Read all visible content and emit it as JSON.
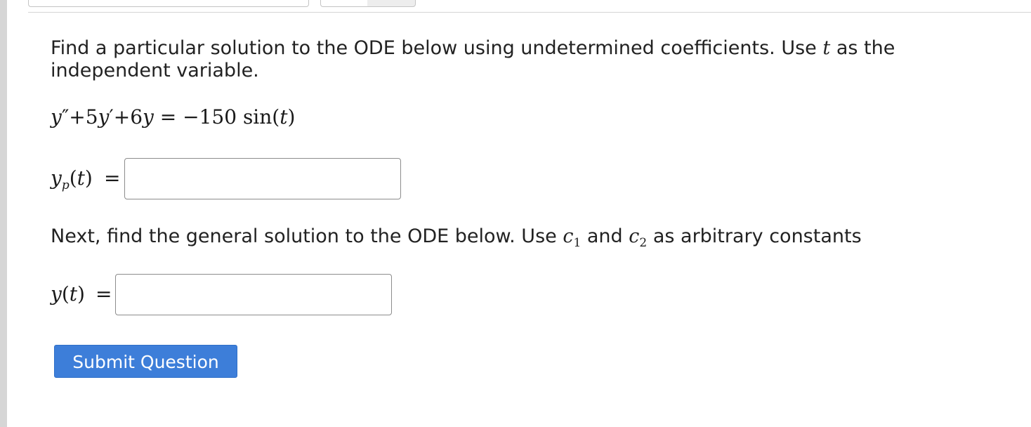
{
  "question": {
    "intro_before_var": "Find a particular solution to the ODE below using undetermined coefficients. Use",
    "independent_var": "t",
    "intro_after_var": "as the independent variable.",
    "equation": {
      "lhs_y1": "y",
      "lhs_primes": "″",
      "plus1": "+5",
      "lhs_y2": "y",
      "prime1": "′",
      "plus2": "+6",
      "lhs_y3": "y",
      "rhs": " = −150 sin(",
      "rhs_var": "t",
      "rhs_close": ")"
    },
    "particular_label": {
      "y": "y",
      "sub": "p",
      "open": "(",
      "var": "t",
      "close": ")",
      "equals": "="
    },
    "next_before_c1": "Next, find the general solution to the ODE below. Use",
    "c1": "c",
    "c1_sub": "1",
    "and_text": "and",
    "c2": "c",
    "c2_sub": "2",
    "next_after": "as arbitrary constants",
    "general_label": {
      "y": "y",
      "open": "(",
      "var": "t",
      "close": ")",
      "equals": "="
    }
  },
  "inputs": {
    "particular_value": "",
    "general_value": ""
  },
  "submit_label": "Submit Question",
  "colors": {
    "button_bg": "#3d7ed9",
    "button_text": "#ffffff",
    "input_border": "#8c8c8c"
  }
}
